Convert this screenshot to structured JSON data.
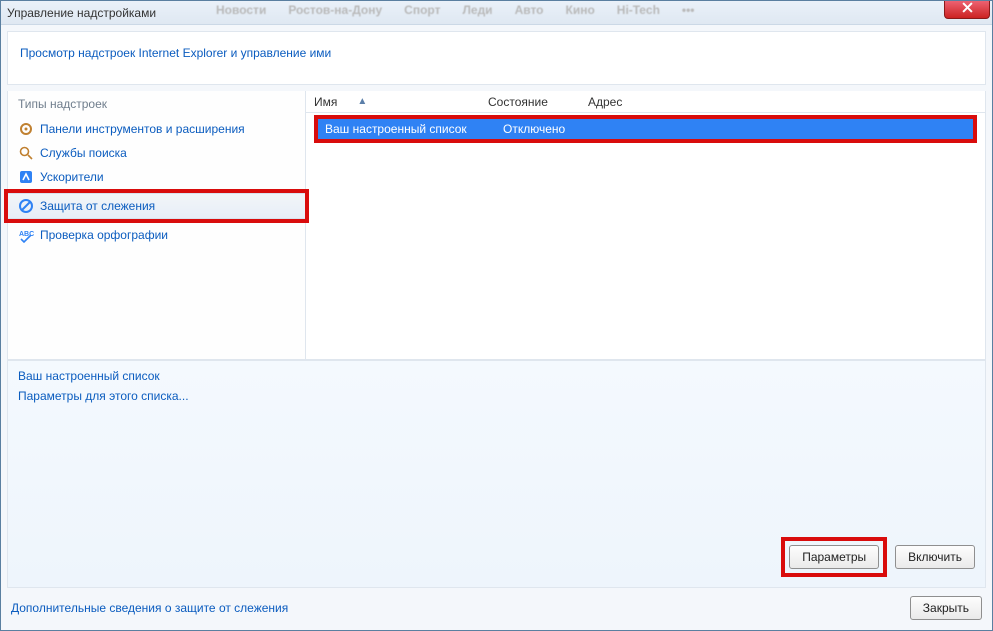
{
  "window": {
    "title": "Управление надстройками"
  },
  "bgnav": [
    "Новости",
    "Ростов-на-Дону",
    "Спорт",
    "Леди",
    "Авто",
    "Кино",
    "Hi-Tech",
    "•••"
  ],
  "header": {
    "link": "Просмотр надстроек Internet Explorer и управление ими"
  },
  "sidebar": {
    "heading": "Типы надстроек",
    "items": [
      {
        "label": "Панели инструментов и расширения",
        "icon": "gear"
      },
      {
        "label": "Службы поиска",
        "icon": "search"
      },
      {
        "label": "Ускорители",
        "icon": "accel"
      },
      {
        "label": "Защита от слежения",
        "icon": "block",
        "selected": true
      },
      {
        "label": "Проверка орфографии",
        "icon": "spell"
      }
    ]
  },
  "columns": {
    "name": "Имя",
    "status": "Состояние",
    "address": "Адрес"
  },
  "rows": [
    {
      "name": "Ваш настроенный список",
      "status": "Отключено"
    }
  ],
  "details": {
    "title_link": "Ваш настроенный список",
    "params_link": "Параметры для этого списка..."
  },
  "buttons": {
    "params": "Параметры",
    "enable": "Включить",
    "close": "Закрыть"
  },
  "footer": {
    "more_link": "Дополнительные сведения о защите от слежения"
  }
}
